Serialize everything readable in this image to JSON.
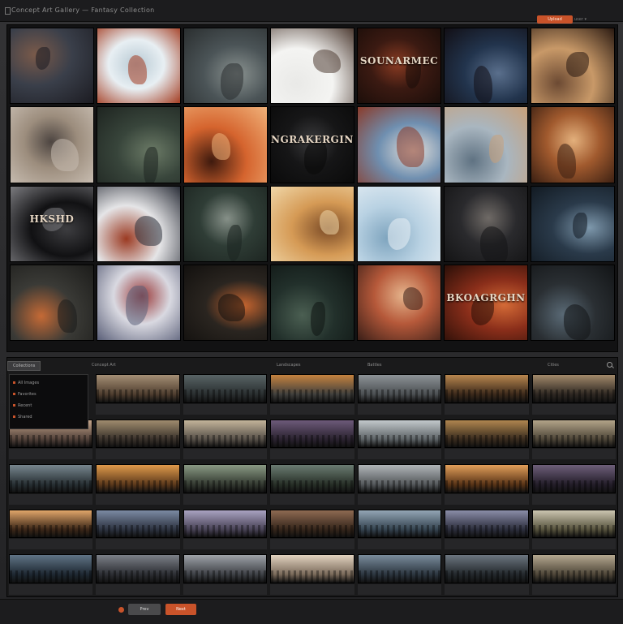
{
  "window": {
    "title": "Concept Art Gallery — Fantasy Collection",
    "top_button": "Upload",
    "top_right_text": "user ▾"
  },
  "top_grid": {
    "tiles": [
      {
        "caption": "",
        "text": "",
        "colors": [
          "#3a3f4a",
          "#7a5a4a",
          "#1c1c22"
        ]
      },
      {
        "caption": "",
        "text": "",
        "colors": [
          "#e8eff3",
          "#b7c9d3",
          "#a43d22"
        ]
      },
      {
        "caption": "",
        "text": "",
        "colors": [
          "#4b5457",
          "#8a9290",
          "#2a2e2f"
        ]
      },
      {
        "caption": "",
        "text": "",
        "colors": [
          "#f4f4f2",
          "#e9e9e7",
          "#4e3c33"
        ]
      },
      {
        "caption": "",
        "text": "SOUNARMEC",
        "colors": [
          "#3b1a12",
          "#8a3b22",
          "#1a0d09"
        ]
      },
      {
        "caption": "",
        "text": "",
        "colors": [
          "#22344d",
          "#5a6f8c",
          "#120f15"
        ]
      },
      {
        "caption": "",
        "text": "",
        "colors": [
          "#c89968",
          "#6c4a33",
          "#2a1a12"
        ]
      },
      {
        "caption": "",
        "text": "",
        "colors": [
          "#9c8d7d",
          "#4d4541",
          "#c7bcb0"
        ]
      },
      {
        "caption": "",
        "text": "",
        "colors": [
          "#38453b",
          "#6b7a66",
          "#1e2420"
        ]
      },
      {
        "caption": "",
        "text": "",
        "colors": [
          "#d5642e",
          "#3e1a0e",
          "#f0b27a"
        ]
      },
      {
        "caption": "",
        "text": "NGRAKERGINU",
        "colors": [
          "#161617",
          "#3a3a3c",
          "#0a0a0a"
        ]
      },
      {
        "caption": "",
        "text": "",
        "colors": [
          "#6f8fb0",
          "#e6e1da",
          "#8a3b2a"
        ]
      },
      {
        "caption": "",
        "text": "",
        "colors": [
          "#a9b6c0",
          "#5f7282",
          "#c8a07a"
        ]
      },
      {
        "caption": "",
        "text": "",
        "colors": [
          "#a15a2e",
          "#e3b07c",
          "#3a1f12"
        ]
      },
      {
        "caption": "",
        "text": "HKSHD",
        "colors": [
          "#111113",
          "#3d3d40",
          "#7c7c80"
        ]
      },
      {
        "caption": "",
        "text": "",
        "colors": [
          "#e5e5e7",
          "#9b3a22",
          "#2a2e38"
        ]
      },
      {
        "caption": "",
        "text": "",
        "colors": [
          "#2f3d36",
          "#869088",
          "#1c2420"
        ]
      },
      {
        "caption": "",
        "text": "",
        "colors": [
          "#d59a55",
          "#7a4a26",
          "#f0d7a8"
        ]
      },
      {
        "caption": "",
        "text": "",
        "colors": [
          "#b9d2e3",
          "#7ea4be",
          "#e9f0f5"
        ]
      },
      {
        "caption": "",
        "text": "",
        "colors": [
          "#2a2a2d",
          "#6f6a66",
          "#141415"
        ]
      },
      {
        "caption": "",
        "text": "",
        "colors": [
          "#2a3a4a",
          "#7e98ac",
          "#121a22"
        ]
      },
      {
        "caption": "",
        "text": "",
        "colors": [
          "#3a3a36",
          "#c56a36",
          "#1c1c1a"
        ]
      },
      {
        "caption": "",
        "text": "",
        "colors": [
          "#d9d9e1",
          "#9a3a3a",
          "#5a5f78"
        ]
      },
      {
        "caption": "",
        "text": "",
        "colors": [
          "#2a2520",
          "#c7652f",
          "#12100e"
        ]
      },
      {
        "caption": "",
        "text": "",
        "colors": [
          "#22302b",
          "#4b5f52",
          "#0e1412"
        ]
      },
      {
        "caption": "",
        "text": "",
        "colors": [
          "#b6593a",
          "#e5b48c",
          "#3a1f18"
        ]
      },
      {
        "caption": "",
        "text": "BKOAGRGHN",
        "colors": [
          "#8a2e1a",
          "#d36a36",
          "#2a0f08"
        ]
      },
      {
        "caption": "",
        "text": "",
        "colors": [
          "#2a2f33",
          "#5a6a76",
          "#121416"
        ]
      }
    ]
  },
  "bottom_panel": {
    "tabs": [
      {
        "label": "Collections",
        "active": true
      },
      {
        "label": "Concept Art",
        "active": false
      },
      {
        "label": "",
        "active": false
      },
      {
        "label": "Landscapes",
        "active": false
      },
      {
        "label": "Battles",
        "active": false
      },
      {
        "label": "",
        "active": false
      },
      {
        "label": "Cities",
        "active": false
      }
    ],
    "sidebar_rows": [
      "All Images",
      "Favorites",
      "Recent",
      "Shared"
    ],
    "cells": [
      {
        "empty": true
      },
      {
        "label": "",
        "colors": [
          "#a58f75",
          "#4f3e2f"
        ]
      },
      {
        "label": "",
        "colors": [
          "#596466",
          "#2a2f30"
        ]
      },
      {
        "label": "",
        "colors": [
          "#c5823f",
          "#41403d"
        ]
      },
      {
        "label": "",
        "colors": [
          "#8d9397",
          "#4b4f52"
        ]
      },
      {
        "label": "",
        "colors": [
          "#b9874f",
          "#3d2a1b"
        ]
      },
      {
        "label": "",
        "colors": [
          "#a38a6b",
          "#2f2822"
        ]
      },
      {
        "label": "",
        "colors": [
          "#c4a58a",
          "#53423a"
        ]
      },
      {
        "label": "",
        "colors": [
          "#a08c6e",
          "#3a322b"
        ]
      },
      {
        "label": "",
        "colors": [
          "#c3b49a",
          "#585149"
        ]
      },
      {
        "label": "",
        "colors": [
          "#6d5a7a",
          "#2b2330"
        ]
      },
      {
        "label": "",
        "colors": [
          "#c3c9cc",
          "#5e6467"
        ]
      },
      {
        "label": "",
        "colors": [
          "#b0864f",
          "#3a2c1e"
        ]
      },
      {
        "label": "",
        "colors": [
          "#b3a489",
          "#4e4638"
        ]
      },
      {
        "label": "",
        "colors": [
          "#77868e",
          "#283034"
        ]
      },
      {
        "label": "",
        "colors": [
          "#e09a4b",
          "#5e3a1c"
        ]
      },
      {
        "label": "",
        "colors": [
          "#8a9a84",
          "#343a31"
        ]
      },
      {
        "label": "",
        "colors": [
          "#6b7c72",
          "#283028"
        ]
      },
      {
        "label": "",
        "colors": [
          "#b1b5b8",
          "#55595c"
        ]
      },
      {
        "label": "",
        "colors": [
          "#e29f5a",
          "#5b3517"
        ]
      },
      {
        "label": "",
        "colors": [
          "#6e5f7a",
          "#241e2a"
        ]
      },
      {
        "label": "",
        "colors": [
          "#e0a66a",
          "#3e2818"
        ]
      },
      {
        "label": "",
        "colors": [
          "#7b8aa3",
          "#2e3442"
        ]
      },
      {
        "label": "",
        "colors": [
          "#a9a2c1",
          "#4a4458"
        ]
      },
      {
        "label": "",
        "colors": [
          "#8e6a52",
          "#36261b"
        ]
      },
      {
        "label": "",
        "colors": [
          "#93a5b5",
          "#364552"
        ]
      },
      {
        "label": "",
        "colors": [
          "#8a8da8",
          "#2d2f3e"
        ]
      },
      {
        "label": "",
        "colors": [
          "#cbc5b0",
          "#59553f"
        ]
      },
      {
        "label": "",
        "colors": [
          "#607486",
          "#1e2832"
        ]
      },
      {
        "label": "",
        "colors": [
          "#7c8088",
          "#2c2e33"
        ]
      },
      {
        "label": "",
        "colors": [
          "#9fa3a9",
          "#3e4146"
        ]
      },
      {
        "label": "",
        "colors": [
          "#e2d3c0",
          "#7a6a5a"
        ]
      },
      {
        "label": "",
        "colors": [
          "#7a8c9c",
          "#2c3640"
        ]
      },
      {
        "label": "",
        "colors": [
          "#6c7680",
          "#23282c"
        ]
      },
      {
        "label": "",
        "colors": [
          "#b5a890",
          "#4e4638"
        ]
      }
    ]
  },
  "status": {
    "text": "",
    "button_grey": "Prev",
    "button_orange": "Next"
  }
}
